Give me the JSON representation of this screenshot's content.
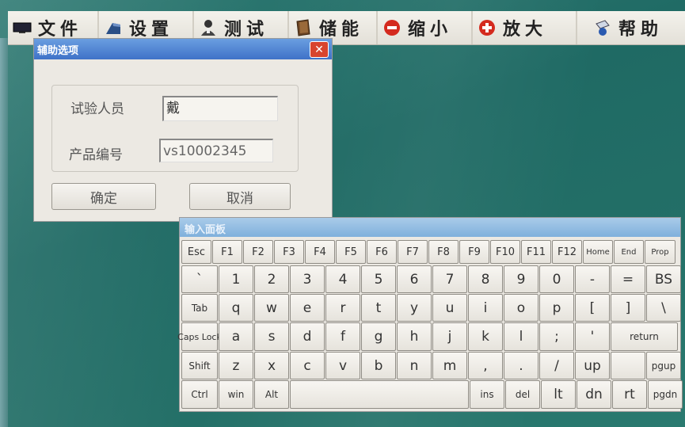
{
  "toolbar": {
    "items": [
      {
        "label": "文件",
        "icon": "monitor-icon"
      },
      {
        "label": "设置",
        "icon": "settings-icon"
      },
      {
        "label": "测试",
        "icon": "person-icon"
      },
      {
        "label": "储能",
        "icon": "book-icon"
      },
      {
        "label": "缩小",
        "icon": "minus-circle-icon"
      },
      {
        "label": "放大",
        "icon": "plus-circle-icon"
      },
      {
        "label": "帮助",
        "icon": "help-icon"
      }
    ]
  },
  "dialog": {
    "title": "辅助选项",
    "close_label": "✕",
    "tester_label": "试验人员",
    "tester_value": "戴",
    "product_label": "产品编号",
    "product_value": "vs10002345",
    "ok_label": "确定",
    "cancel_label": "取消"
  },
  "keyboard": {
    "title": "输入面板",
    "rows": [
      [
        "Esc",
        "F1",
        "F2",
        "F3",
        "F4",
        "F5",
        "F6",
        "F7",
        "F8",
        "F9",
        "F10",
        "F11",
        "F12",
        "Home",
        "End",
        "Prop"
      ],
      [
        "`",
        "1",
        "2",
        "3",
        "4",
        "5",
        "6",
        "7",
        "8",
        "9",
        "0",
        "-",
        "=",
        "BS"
      ],
      [
        "Tab",
        "q",
        "w",
        "e",
        "r",
        "t",
        "y",
        "u",
        "i",
        "o",
        "p",
        "[",
        "]",
        "\\"
      ],
      [
        "Caps Lock",
        "a",
        "s",
        "d",
        "f",
        "g",
        "h",
        "j",
        "k",
        "l",
        ";",
        "'",
        "return"
      ],
      [
        "Shift",
        "z",
        "x",
        "c",
        "v",
        "b",
        "n",
        "m",
        ",",
        ".",
        "/",
        "up",
        "",
        "pgup"
      ],
      [
        "Ctrl",
        "win",
        "Alt",
        "",
        "ins",
        "del",
        "lt",
        "dn",
        "rt",
        "pgdn"
      ]
    ]
  },
  "colors": {
    "desktop": "#236f67",
    "dialog_title": "#3f72c8",
    "keyboard_title": "#7fb0dc",
    "close_button": "#d8442e"
  }
}
